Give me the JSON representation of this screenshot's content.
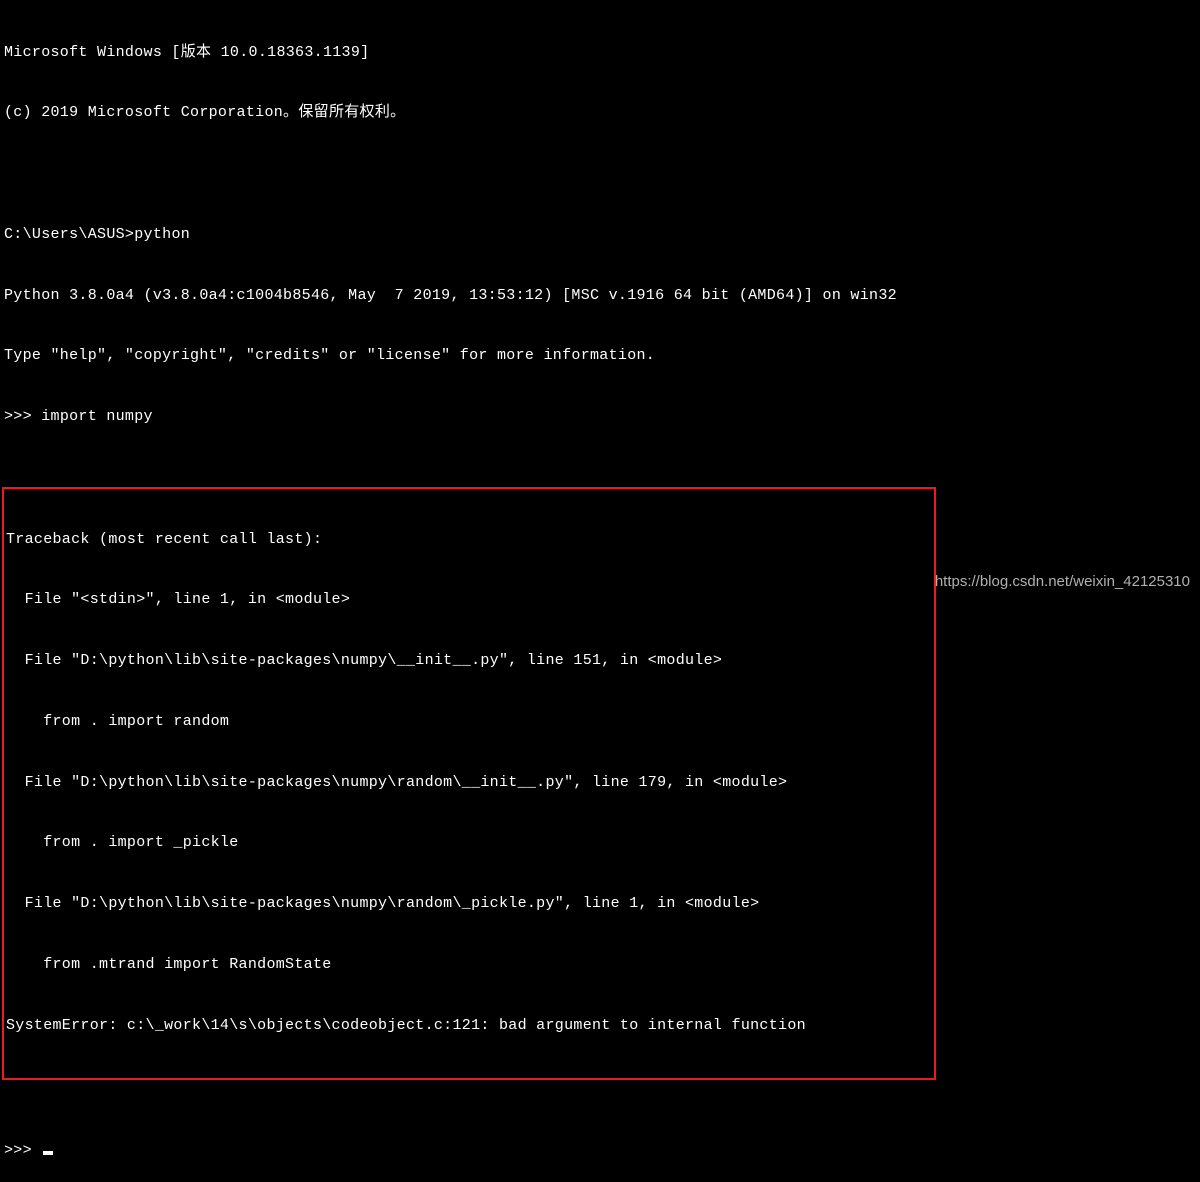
{
  "header": {
    "line1": "Microsoft Windows [版本 10.0.18363.1139]",
    "line2": "(c) 2019 Microsoft Corporation。保留所有权利。"
  },
  "cwd_prompt": "C:\\Users\\ASUS>",
  "command": "python",
  "python_banner": {
    "line1": "Python 3.8.0a4 (v3.8.0a4:c1004b8546, May  7 2019, 13:53:12) [MSC v.1916 64 bit (AMD64)] on win32",
    "line2": "Type \"help\", \"copyright\", \"credits\" or \"license\" for more information."
  },
  "repl_prompt": ">>> ",
  "import_cmd": "import numpy",
  "traceback": {
    "header": "Traceback (most recent call last):",
    "frames": [
      {
        "loc": "  File \"<stdin>\", line 1, in <module>"
      },
      {
        "loc": "  File \"D:\\python\\lib\\site-packages\\numpy\\__init__.py\", line 151, in <module>",
        "src": "    from . import random"
      },
      {
        "loc": "  File \"D:\\python\\lib\\site-packages\\numpy\\random\\__init__.py\", line 179, in <module>",
        "src": "    from . import _pickle"
      },
      {
        "loc": "  File \"D:\\python\\lib\\site-packages\\numpy\\random\\_pickle.py\", line 1, in <module>",
        "src": "    from .mtrand import RandomState"
      }
    ],
    "error": "SystemError: c:\\_work\\14\\s\\objects\\codeobject.c:121: bad argument to internal function"
  },
  "watermark": "https://blog.csdn.net/weixin_42125310"
}
